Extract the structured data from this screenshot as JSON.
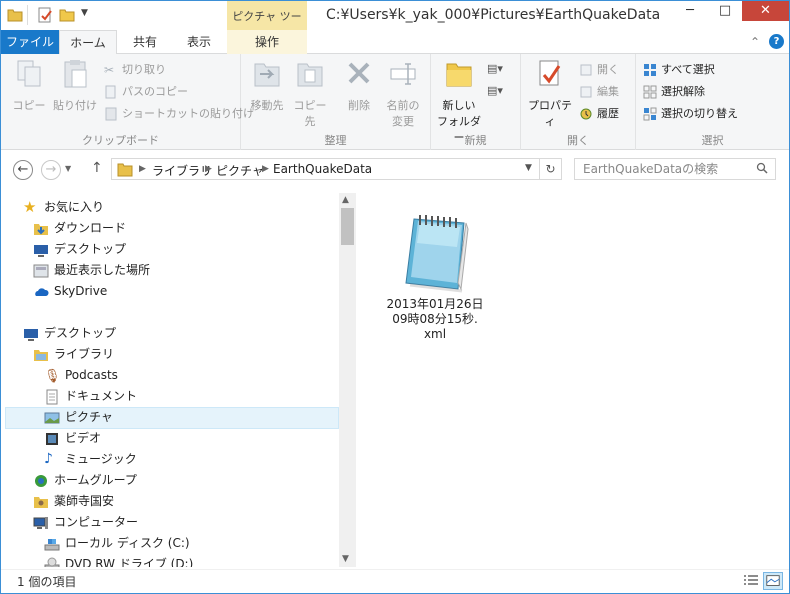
{
  "window": {
    "title": "C:¥Users¥k_yak_000¥Pictures¥EarthQuakeData",
    "contextual_tab_group": "ピクチャ ツール",
    "minimize": "─",
    "maximize": "□",
    "close": "✕"
  },
  "tabs": {
    "file": "ファイル",
    "home": "ホーム",
    "share": "共有",
    "view": "表示",
    "manage": "操作"
  },
  "ribbon": {
    "clipboard": {
      "label": "クリップボード",
      "copy": "コピー",
      "paste": "貼り付け",
      "cut": "切り取り",
      "copy_path": "パスのコピー",
      "paste_shortcut": "ショートカットの貼り付け"
    },
    "organize": {
      "label": "整理",
      "move_to": "移動先",
      "copy_to": "コピー先",
      "delete": "削除",
      "rename_line1": "名前の",
      "rename_line2": "変更"
    },
    "new": {
      "label": "新規",
      "new_folder_line1": "新しい",
      "new_folder_line2": "フォルダー"
    },
    "open": {
      "label": "開く",
      "properties": "プロパティ",
      "open": "開く",
      "edit": "編集",
      "history": "履歴"
    },
    "select": {
      "label": "選択",
      "select_all": "すべて選択",
      "select_none": "選択解除",
      "invert": "選択の切り替え"
    }
  },
  "address": {
    "crumbs": [
      "ライブラリ",
      "ピクチャ",
      "EarthQuakeData"
    ]
  },
  "search": {
    "placeholder": "EarthQuakeDataの検索"
  },
  "nav": {
    "favorites": "お気に入り",
    "downloads": "ダウンロード",
    "desktop_fav": "デスクトップ",
    "recent": "最近表示した場所",
    "skydrive": "SkyDrive",
    "desktop": "デスクトップ",
    "libraries": "ライブラリ",
    "podcasts": "Podcasts",
    "documents": "ドキュメント",
    "pictures": "ピクチャ",
    "videos": "ビデオ",
    "music": "ミュージック",
    "homegroup": "ホームグループ",
    "user": "薬師寺国安",
    "computer": "コンピューター",
    "local_disk": "ローカル ディスク (C:)",
    "dvd": "DVD RW ドライブ (D:)"
  },
  "files": [
    {
      "line1": "2013年01月26日",
      "line2": "09時08分15秒.",
      "line3": "xml"
    }
  ],
  "status": {
    "count": "1 個の項目"
  },
  "colors": {
    "accent": "#1979ca",
    "selected": "#e5f3fb",
    "context_tab": "#f6e6a6",
    "close": "#c7463a"
  }
}
